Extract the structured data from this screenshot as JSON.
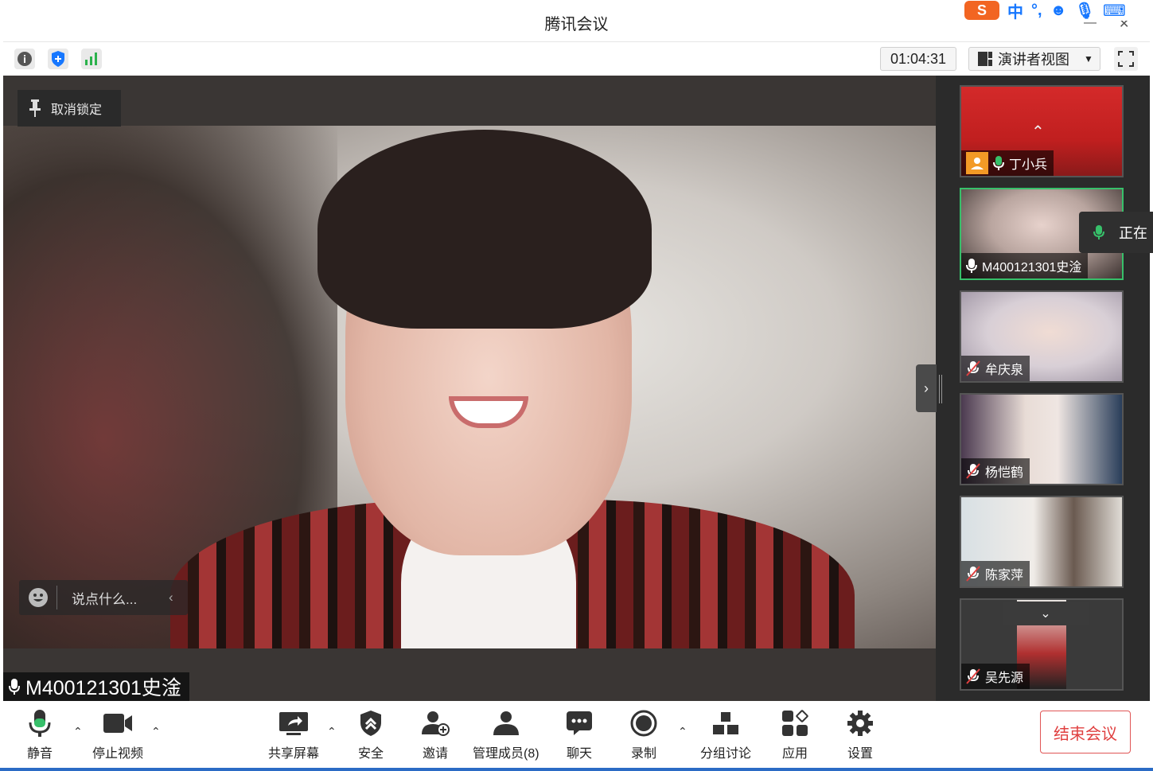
{
  "window": {
    "title": "腾讯会议"
  },
  "infobar": {
    "timer": "01:04:31",
    "view_label": "演讲者视图",
    "icons": [
      "info-icon",
      "shield-icon",
      "signal-icon"
    ]
  },
  "main": {
    "unlock_label": "取消锁定",
    "chat_placeholder": "说点什么...",
    "speaker_name": "M400121301史淦"
  },
  "participants": [
    {
      "name": "丁小兵",
      "mic": "on",
      "has_avatar_badge": true
    },
    {
      "name": "M400121301史淦",
      "mic": "on-white",
      "active": true
    },
    {
      "name": "牟庆泉",
      "mic": "muted"
    },
    {
      "name": "杨恺鹤",
      "mic": "muted"
    },
    {
      "name": "陈家萍",
      "mic": "muted"
    },
    {
      "name": "吴先源",
      "mic": "muted"
    }
  ],
  "speaking_popup": {
    "text": "正在"
  },
  "toolbar": {
    "mute": "静音",
    "stop_video": "停止视频",
    "share": "共享屏幕",
    "security": "安全",
    "invite": "邀请",
    "members": "管理成员(8)",
    "chat": "聊天",
    "record": "录制",
    "breakout": "分组讨论",
    "apps": "应用",
    "settings": "设置",
    "end": "结束会议"
  },
  "ime": {
    "logo": "S",
    "mode": "中"
  },
  "colors": {
    "accent_green": "#37c06a",
    "end_red": "#e04040",
    "shield_blue": "#1677ff"
  }
}
